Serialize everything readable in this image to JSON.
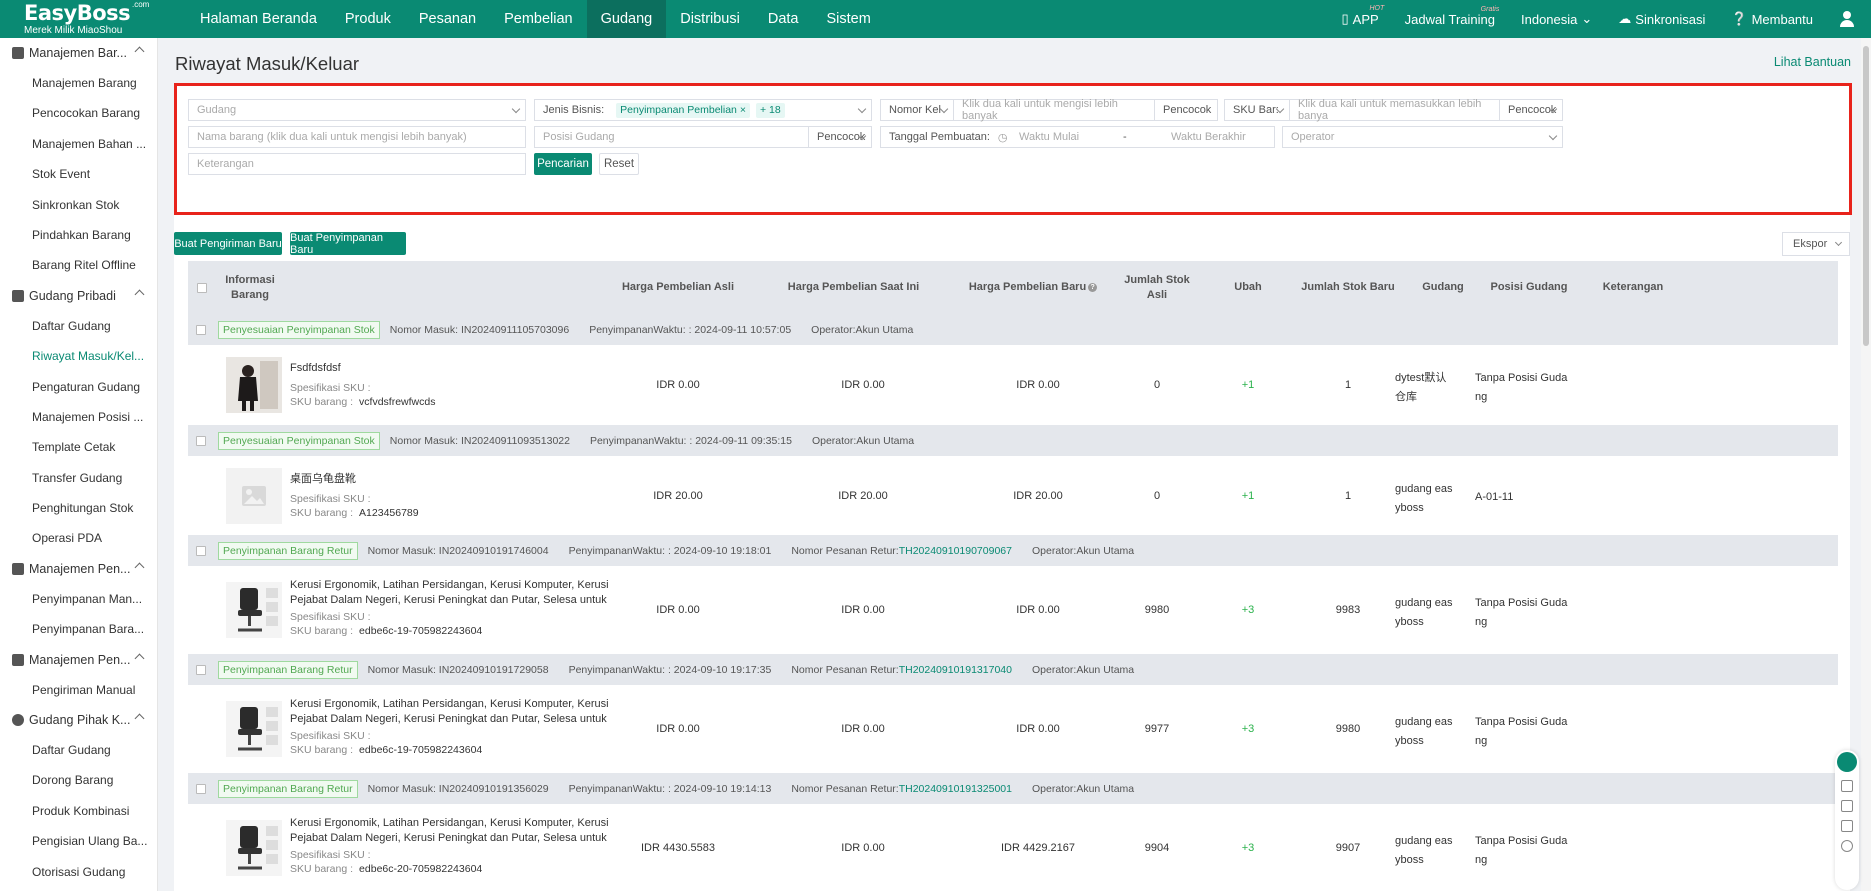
{
  "brand": {
    "name": "EasyBoss",
    "com": ".com",
    "tagline": "Merek Milik MiaoShou"
  },
  "nav": {
    "items": [
      "Halaman Beranda",
      "Produk",
      "Pesanan",
      "Pembelian",
      "Gudang",
      "Distribusi",
      "Data",
      "Sistem"
    ],
    "active": "Gudang"
  },
  "topbar": {
    "app": "APP",
    "app_badge": "HOT",
    "training": "Jadwal Training",
    "training_badge": "Gratis",
    "language": "Indonesia",
    "sync": "Sinkronisasi",
    "help": "Membantu"
  },
  "sidebar": {
    "sections": [
      {
        "title": "Manajemen Bar...",
        "items": [
          "Manajemen Barang",
          "Pencocokan Barang",
          "Manajemen Bahan ...",
          "Stok Event",
          "Sinkronkan Stok",
          "Pindahkan Barang",
          "Barang Ritel Offline"
        ]
      },
      {
        "title": "Gudang Pribadi",
        "items": [
          "Daftar Gudang",
          "Riwayat Masuk/Kel...",
          "Pengaturan Gudang",
          "Manajemen Posisi ...",
          "Template Cetak",
          "Transfer Gudang",
          "Penghitungan Stok",
          "Operasi PDA"
        ]
      },
      {
        "title": "Manajemen Pen...",
        "items": [
          "Penyimpanan Man...",
          "Penyimpanan Bara..."
        ]
      },
      {
        "title": "Manajemen Pen...",
        "items": [
          "Pengiriman Manual"
        ]
      },
      {
        "title": "Gudang Pihak K...",
        "items": [
          "Daftar Gudang",
          "Dorong Barang",
          "Produk Kombinasi",
          "Pengisian Ulang Ba...",
          "Otorisasi Gudang"
        ]
      }
    ],
    "active_item": "Riwayat Masuk/Kel..."
  },
  "page": {
    "title": "Riwayat Masuk/Keluar",
    "help_link": "Lihat Bantuan"
  },
  "filters": {
    "gudang_placeholder": "Gudang",
    "jenis_bisnis_label": "Jenis Bisnis:",
    "jenis_bisnis_tag": "Penyimpanan Pembelian",
    "jenis_bisnis_tag_close": "×",
    "jenis_bisnis_more": "+ 18",
    "nomor_select": "Nomor Kel",
    "nomor_placeholder": "Klik dua kali untuk mengisi lebih banyak",
    "nomor_match": "Pencocok",
    "sku_select": "SKU Bar:",
    "sku_placeholder": "Klik dua kali untuk memasukkan lebih banya",
    "sku_match": "Pencocok",
    "nama_placeholder": "Nama barang (klik dua kali untuk mengisi lebih banyak)",
    "posisi_placeholder": "Posisi Gudang",
    "posisi_match": "Pencocok",
    "tanggal_label": "Tanggal Pembuatan:",
    "start_placeholder": "Waktu Mulai",
    "range_sep": "-",
    "end_placeholder": "Waktu Berakhir",
    "operator_placeholder": "Operator",
    "keterangan_placeholder": "Keterangan",
    "search_btn": "Pencarian",
    "reset_btn": "Reset"
  },
  "actions": {
    "new_shipment": "Buat Pengiriman Baru",
    "new_storage": "Buat Penyimpanan Baru",
    "export": "Ekspor"
  },
  "table": {
    "headers": {
      "info": "Informasi Barang",
      "harga_asli": "Harga Pembelian Asli",
      "harga_kini": "Harga Pembelian Saat Ini",
      "harga_baru": "Harga Pembelian Baru",
      "stok_asli": "Jumlah Stok Asli",
      "ubah": "Ubah",
      "stok_baru": "Jumlah Stok Baru",
      "gudang": "Gudang",
      "posisi": "Posisi Gudang",
      "keterangan": "Keterangan"
    },
    "groups": [
      {
        "badge": "Penyesuaian Penyimpanan Stok",
        "nomor": "Nomor Masuk: IN20240911105703096",
        "waktu": "PenyimpananWaktu: : 2024-09-11 10:57:05",
        "retur_label": "",
        "retur_no": "",
        "operator": "Operator:Akun Utama",
        "name": "Fsdfdsfdsf",
        "spec_label": "Spesifikasi SKU :",
        "sku_label": "SKU barang :",
        "sku": "vcfvdsfrewfwcds",
        "harga_asli": "IDR 0.00",
        "harga_kini": "IDR 0.00",
        "harga_baru": "IDR 0.00",
        "stok_asli": "0",
        "ubah": "+1",
        "stok_baru": "1",
        "gudang": "dytest默认\n仓库",
        "posisi": "Tanpa Posisi Guda\nng",
        "thumb": "woman-photo"
      },
      {
        "badge": "Penyesuaian Penyimpanan Stok",
        "nomor": "Nomor Masuk: IN20240911093513022",
        "waktu": "PenyimpananWaktu: : 2024-09-11 09:35:15",
        "retur_label": "",
        "retur_no": "",
        "operator": "Operator:Akun Utama",
        "name": "桌面乌龟盘靴",
        "spec_label": "Spesifikasi SKU :",
        "sku_label": "SKU barang :",
        "sku": "A123456789",
        "harga_asli": "IDR 20.00",
        "harga_kini": "IDR 20.00",
        "harga_baru": "IDR 20.00",
        "stok_asli": "0",
        "ubah": "+1",
        "stok_baru": "1",
        "gudang": "gudang eas\nyboss",
        "posisi": "A-01-11",
        "thumb": "placeholder-image"
      },
      {
        "badge": "Penyimpanan Barang Retur",
        "nomor": "Nomor Masuk: IN20240910191746004",
        "waktu": "PenyimpananWaktu: : 2024-09-10 19:18:01",
        "retur_label": "Nomor Pesanan Retur:",
        "retur_no": "TH20240910190709067",
        "operator": "Operator:Akun Utama",
        "name": "Kerusi Ergonomik, Latihan Persidangan, Kerusi Komputer, Kerusi Pejabat Dalam Negeri, Kerusi Peningkat dan Putar, Selesa untuk Berbohong, Bilik Belaj...",
        "spec_label": "Spesifikasi SKU :",
        "sku_label": "SKU barang :",
        "sku": "edbe6c-19-705982243604",
        "harga_asli": "IDR 0.00",
        "harga_kini": "IDR 0.00",
        "harga_baru": "IDR 0.00",
        "stok_asli": "9980",
        "ubah": "+3",
        "stok_baru": "9983",
        "gudang": "gudang eas\nyboss",
        "posisi": "Tanpa Posisi Guda\nng",
        "thumb": "chair-photo"
      },
      {
        "badge": "Penyimpanan Barang Retur",
        "nomor": "Nomor Masuk: IN20240910191729058",
        "waktu": "PenyimpananWaktu: : 2024-09-10 19:17:35",
        "retur_label": "Nomor Pesanan Retur:",
        "retur_no": "TH20240910191317040",
        "operator": "Operator:Akun Utama",
        "name": "Kerusi Ergonomik, Latihan Persidangan, Kerusi Komputer, Kerusi Pejabat Dalam Negeri, Kerusi Peningkat dan Putar, Selesa untuk Berbohong, Bilik Belaj...",
        "spec_label": "Spesifikasi SKU :",
        "sku_label": "SKU barang :",
        "sku": "edbe6c-19-705982243604",
        "harga_asli": "IDR 0.00",
        "harga_kini": "IDR 0.00",
        "harga_baru": "IDR 0.00",
        "stok_asli": "9977",
        "ubah": "+3",
        "stok_baru": "9980",
        "gudang": "gudang eas\nyboss",
        "posisi": "Tanpa Posisi Guda\nng",
        "thumb": "chair-photo"
      },
      {
        "badge": "Penyimpanan Barang Retur",
        "nomor": "Nomor Masuk: IN20240910191356029",
        "waktu": "PenyimpananWaktu: : 2024-09-10 19:14:13",
        "retur_label": "Nomor Pesanan Retur:",
        "retur_no": "TH20240910191325001",
        "operator": "Operator:Akun Utama",
        "name": "Kerusi Ergonomik, Latihan Persidangan, Kerusi Komputer, Kerusi Pejabat Dalam Negeri, Kerusi Peningkat dan Putar, Selesa untuk Berbohong, Bilik Belaj...",
        "spec_label": "Spesifikasi SKU :",
        "sku_label": "SKU barang :",
        "sku": "edbe6c-20-705982243604",
        "harga_asli": "IDR 4430.5583",
        "harga_kini": "IDR 0.00",
        "harga_baru": "IDR 4429.2167",
        "stok_asli": "9904",
        "ubah": "+3",
        "stok_baru": "9907",
        "gudang": "gudang eas\nyboss",
        "posisi": "Tanpa Posisi Guda\nng",
        "thumb": "chair-photo"
      }
    ]
  },
  "colors": {
    "brand": "#0a8a73",
    "highlight_box": "#e8231b",
    "increase": "#2bb24c"
  }
}
